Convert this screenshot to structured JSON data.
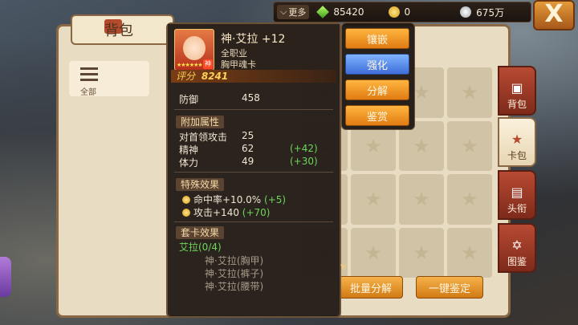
{
  "topbar": {
    "more_label": "更多",
    "gems": "85420",
    "gold": "0",
    "silver": "675万"
  },
  "close_label": "X",
  "bag_panel": {
    "title": "背包",
    "filter_label": "全部"
  },
  "side_tabs": [
    {
      "label": "背包",
      "icon": "bag-icon"
    },
    {
      "label": "卡包",
      "icon": "star-card-icon"
    },
    {
      "label": "头衔",
      "icon": "scroll-icon"
    },
    {
      "label": "图鉴",
      "icon": "hexagram-icon"
    }
  ],
  "bottom_buttons": {
    "batch_decompose": "批量分解",
    "one_click_appraise": "一键鉴定"
  },
  "card": {
    "name": "神·艾拉 +12",
    "class": "全职业",
    "type": "胸甲魂卡",
    "score_label": "评分",
    "score_value": "8241",
    "portrait_badge": "神",
    "base_stat": {
      "label": "防御",
      "value": "458"
    },
    "bonus_section": "附加属性",
    "bonus_stats": [
      {
        "label": "对首领攻击",
        "value": "25",
        "bonus": ""
      },
      {
        "label": "精神",
        "value": "62",
        "bonus": "(+42)"
      },
      {
        "label": "体力",
        "value": "49",
        "bonus": "(+30)"
      }
    ],
    "special_section": "特殊效果",
    "special_effects": [
      {
        "text": "命中率+10.0%",
        "bonus": "(+5)"
      },
      {
        "text": "攻击+140",
        "bonus": "(+70)"
      }
    ],
    "set_section": "套卡效果",
    "set_name": "艾拉(0/4)",
    "set_items": [
      "神·艾拉(胸甲)",
      "神·艾拉(裤子)",
      "神·艾拉(腰带)"
    ]
  },
  "action_menu": [
    {
      "label": "镶嵌",
      "style": "orange"
    },
    {
      "label": "强化",
      "style": "blue"
    },
    {
      "label": "分解",
      "style": "orange"
    },
    {
      "label": "鉴赏",
      "style": "orange"
    }
  ],
  "colors": {
    "accent_orange": "#e07b12",
    "selected_blue": "#3e6ed8",
    "bonus_green": "#6ed65a",
    "score_gold": "#ffcf5a"
  }
}
